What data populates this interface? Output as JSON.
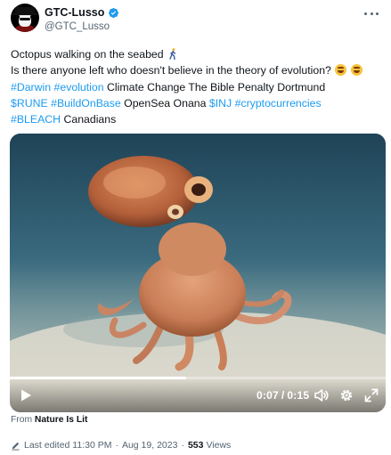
{
  "author": {
    "display_name": "GTC-Lusso",
    "handle": "@GTC_Lusso"
  },
  "tweet": {
    "line1": "Octopus walking on the seabed",
    "line2": "Is there anyone left who doesn't believe in the theory of evolution?",
    "line3": {
      "tag1": "#Darwin",
      "tag2": "#evolution",
      "text": " Climate Change The Bible Penalty Dortmund"
    },
    "line4": {
      "tag1": "$RUNE",
      "tag2": "#BuildOnBase",
      "text": " OpenSea Onana ",
      "tag3": "$INJ",
      "tag4": "#cryptocurrencies"
    },
    "line5": {
      "tag1": "#BLEACH",
      "text": " Canadians"
    }
  },
  "video": {
    "current_time": "0:07",
    "separator": "/",
    "duration": "0:15",
    "progress": 0.47
  },
  "source": {
    "prefix": "From ",
    "name": "Nature Is Lit"
  },
  "meta": {
    "edited": "Last edited 11:30 PM",
    "dot1": "·",
    "date": "Aug 19, 2023",
    "dot2": "·",
    "views": "553",
    "views_label": "Views"
  },
  "colors": {
    "link": "#1d9bf0",
    "text": "#0f1419",
    "muted": "#536471"
  },
  "icons": [
    "verified-badge-icon",
    "more-icon",
    "person-walking-icon",
    "rolling-laughing-emoji",
    "play-icon",
    "volume-icon",
    "settings-gear-icon",
    "fullscreen-icon",
    "pencil-icon"
  ]
}
